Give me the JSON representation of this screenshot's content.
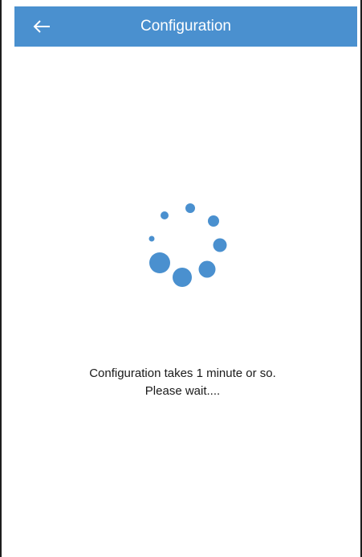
{
  "header": {
    "title": "Configuration",
    "back_icon": "arrow-left-icon",
    "background_color": "#4a90cf"
  },
  "loading": {
    "icon": "loading-spinner-icon",
    "color": "#4a90cf"
  },
  "status": {
    "line1": "Configuration takes 1 minute or so.",
    "line2": "Please wait...."
  }
}
